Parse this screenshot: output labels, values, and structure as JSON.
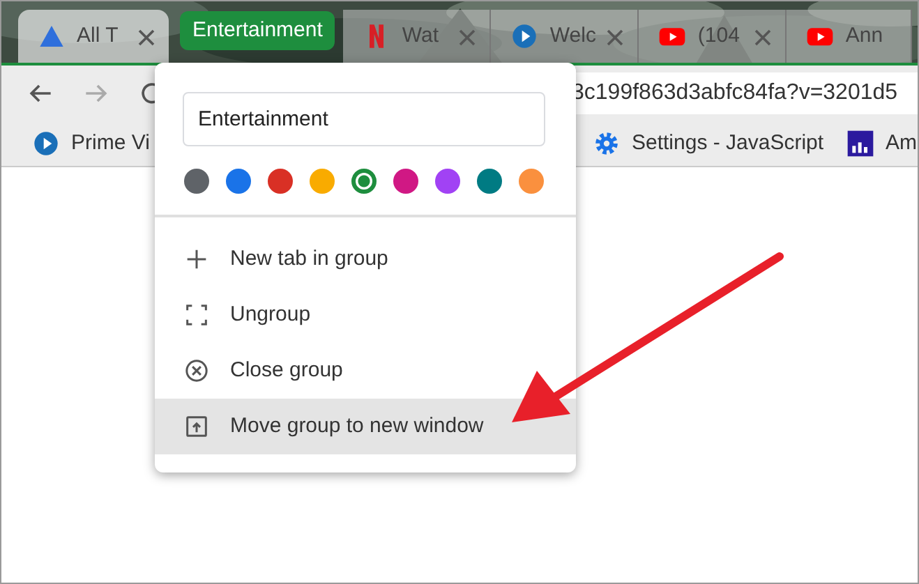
{
  "tabs": [
    {
      "title": "All T",
      "kind": "triangle",
      "selected": true
    },
    {
      "kind": "group",
      "title": "Entertainment",
      "color": "#1e8e3e"
    },
    {
      "title": "Wat",
      "kind": "netflix",
      "selected": false
    },
    {
      "title": "Welc",
      "kind": "play",
      "selected": false
    },
    {
      "title": "(104",
      "kind": "youtube",
      "selected": false
    },
    {
      "title": "Ann",
      "kind": "youtube",
      "selected": false
    }
  ],
  "toolbar": {
    "address": "3c199f863d3abfc84fa?v=3201d5"
  },
  "bookmarks": [
    {
      "title": "Prime Vi",
      "kind": "play"
    },
    {
      "title": "Settings - JavaScript",
      "kind": "gear"
    },
    {
      "title": "Am",
      "kind": "bars"
    }
  ],
  "group_menu": {
    "name": "Entertainment",
    "colors": [
      {
        "color": "#5f6368",
        "selected": false
      },
      {
        "color": "#1a73e8",
        "selected": false
      },
      {
        "color": "#d93025",
        "selected": false
      },
      {
        "color": "#f9ab00",
        "selected": false
      },
      {
        "color": "#1e8e3e",
        "selected": true
      },
      {
        "color": "#d01884",
        "selected": false
      },
      {
        "color": "#a142f4",
        "selected": false
      },
      {
        "color": "#007b83",
        "selected": false
      },
      {
        "color": "#fa903e",
        "selected": false
      }
    ],
    "items": [
      {
        "label": "New tab in group",
        "kind": "plus",
        "highlighted": false
      },
      {
        "label": "Ungroup",
        "kind": "ungroup",
        "highlighted": false
      },
      {
        "label": "Close group",
        "kind": "close-circle",
        "highlighted": false
      },
      {
        "label": "Move group to new window",
        "kind": "move-window",
        "highlighted": true
      }
    ]
  }
}
